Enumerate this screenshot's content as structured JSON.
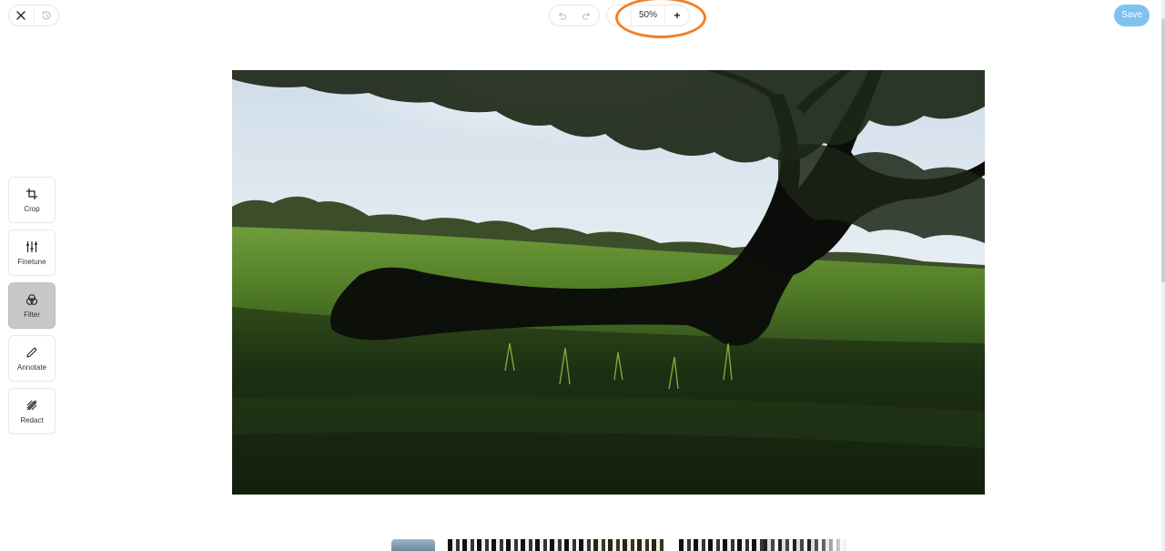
{
  "app": {
    "accent_color": "#7fc2ef",
    "highlight_color": "#f0802a"
  },
  "topbar": {
    "close_icon": "close-icon",
    "history_icon": "history-revert-icon",
    "undo_icon": "undo-icon",
    "redo_icon": "redo-icon",
    "zoom_value": "50%",
    "zoom_in_label": "+",
    "save_label": "Save"
  },
  "tools": [
    {
      "label": "Crop",
      "icon": "crop-icon",
      "active": false
    },
    {
      "label": "Finetune",
      "icon": "sliders-icon",
      "active": false
    },
    {
      "label": "Filter",
      "icon": "filter-circles-icon",
      "active": true
    },
    {
      "label": "Annotate",
      "icon": "pencil-icon",
      "active": false
    },
    {
      "label": "Redact",
      "icon": "redact-hatch-icon",
      "active": false
    }
  ],
  "canvas": {
    "image": "landscape photo: fallen tree trunk on grass field under large tree"
  },
  "filters": {
    "visible_thumbnails": 5
  }
}
